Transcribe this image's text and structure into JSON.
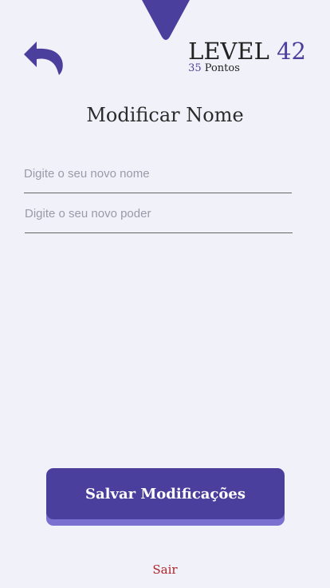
{
  "header": {
    "level_label": "LEVEL",
    "level_value": "42",
    "points_value": "35",
    "points_label": "Pontos"
  },
  "title": "Modificar Nome",
  "form": {
    "name_placeholder": "Digite o seu novo nome",
    "name_value": "",
    "power_placeholder": "Digite o seu novo poder",
    "power_value": ""
  },
  "actions": {
    "save_label": "Salvar Modificações",
    "logout_label": "Sair"
  },
  "colors": {
    "accent": "#4a3f9c",
    "accent_shadow": "#7a70d0",
    "background": "#f1f1fa",
    "danger": "#b0262b"
  },
  "icons": {
    "back": "back-arrow-icon",
    "top_marker": "location-pin-icon"
  }
}
